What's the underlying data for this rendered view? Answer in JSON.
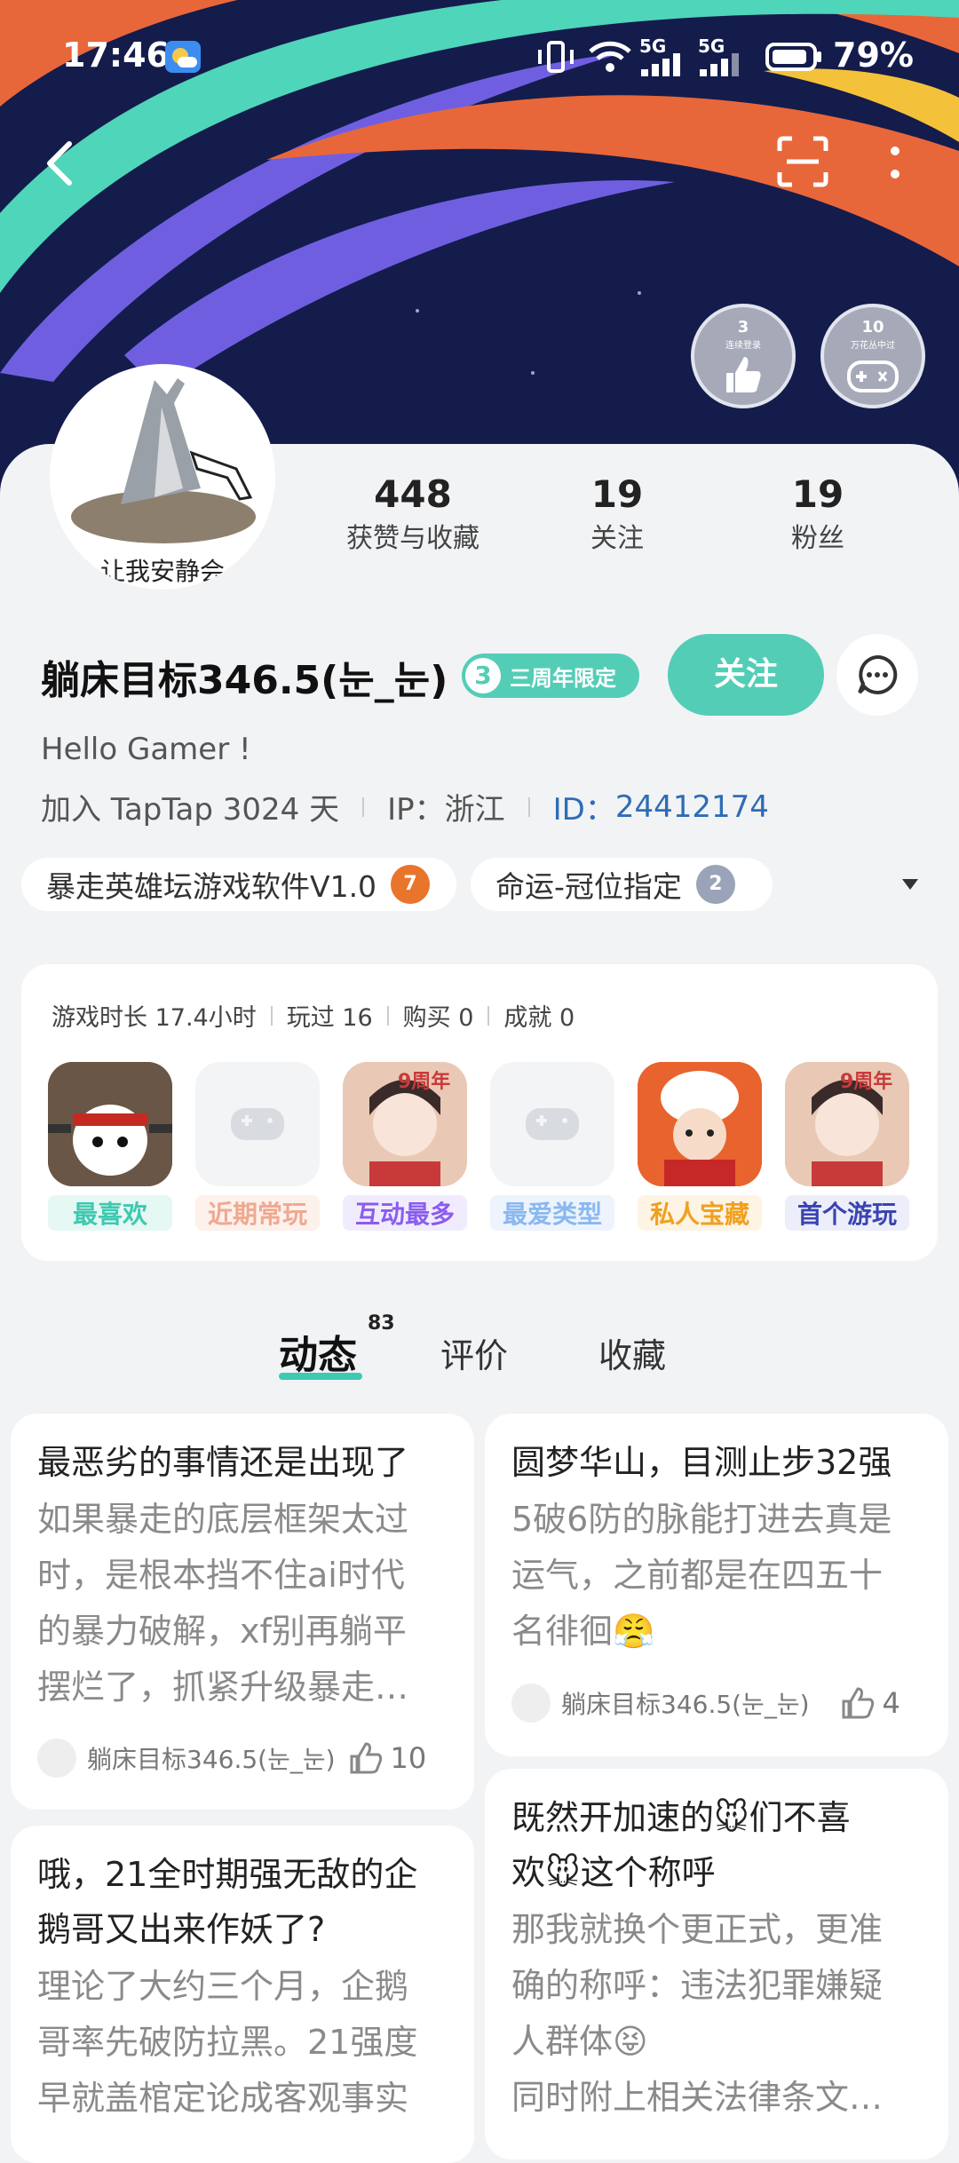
{
  "status_bar": {
    "time": "17:46",
    "battery": "79%",
    "net1": "5G",
    "net2": "5G"
  },
  "badges": [
    {
      "num": "3",
      "sub": "连续登录"
    },
    {
      "num": "10",
      "sub": "万花丛中过"
    }
  ],
  "profile": {
    "avatar_caption": "让我安静会",
    "stats": [
      {
        "value": "448",
        "label": "获赞与收藏"
      },
      {
        "value": "19",
        "label": "关注"
      },
      {
        "value": "19",
        "label": "粉丝"
      }
    ],
    "name": "躺床目标346.5(눈_눈)",
    "anniv_badge": "三周年限定",
    "anniv_num": "3",
    "follow_label": "关注",
    "bio": "Hello Gamer !",
    "join": "加入 TapTap 3024 天",
    "ip": "IP：浙江",
    "id_label": "ID：",
    "id_value": "24412174"
  },
  "tags": [
    {
      "label": "暴走英雄坛游戏软件V1.0",
      "level": "7"
    },
    {
      "label": "命运-冠位指定",
      "level": "2"
    }
  ],
  "game_stats": {
    "items": [
      "游戏时长 17.4小时",
      "玩过 16",
      "购买 0",
      "成就 0"
    ],
    "games": [
      {
        "label": "最喜欢",
        "color": "#3ec9b1"
      },
      {
        "label": "近期常玩",
        "color": "#f0a890"
      },
      {
        "label": "互动最多",
        "color": "#8a5cf0"
      },
      {
        "label": "最爱类型",
        "color": "#8ab8f0"
      },
      {
        "label": "私人宝藏",
        "color": "#f0a020"
      },
      {
        "label": "首个游玩",
        "color": "#3a44b0"
      }
    ],
    "anniv_text": "9周年"
  },
  "tabs": {
    "active": "动态",
    "count": "83",
    "t2": "评价",
    "t3": "收藏"
  },
  "posts": {
    "p1": {
      "title": "最恶劣的事情还是出现了",
      "body": [
        "如果暴走的底层框架太过",
        "时，是根本挡不住ai时代",
        "的暴力破解，xf别再躺平",
        "摆烂了，抓紧升级暴走…"
      ],
      "author": "躺床目标346.5(눈_눈)",
      "likes": "10"
    },
    "p2": {
      "title": "圆梦华山，目测止步32强",
      "body": [
        "5破6防的脉能打进去真是",
        "运气，之前都是在四五十",
        "名徘徊😤"
      ],
      "author": "躺床目标346.5(눈_눈)",
      "likes": "4"
    },
    "p3": {
      "title": [
        "哦，21全时期强无敌的企",
        "鹅哥又出来作妖了?"
      ],
      "body": [
        "理论了大约三个月，企鹅",
        "哥率先破防拉黑。21强度",
        "早就盖棺定论成客观事实"
      ]
    },
    "p4": {
      "title": [
        "既然开加速的🐭们不喜",
        "欢🐭这个称呼"
      ],
      "body": [
        "那我就换个更正式，更准",
        "确的称呼：违法犯罪嫌疑",
        "人群体😝",
        "同时附上相关法律条文…"
      ]
    }
  },
  "colors": {
    "accent": "#3ec9b1",
    "id_blue": "#2e6db5"
  }
}
